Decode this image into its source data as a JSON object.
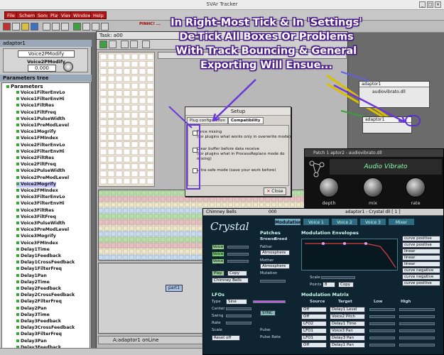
{
  "app": {
    "title": "SVAr Tracker"
  },
  "menu": [
    "File",
    "Scheme",
    "Song",
    "Play",
    "View",
    "Windows",
    "Help"
  ],
  "toolbar": {
    "status": "PINHC! ..."
  },
  "left_panel": {
    "header": "adaptor1",
    "device_name": "Voice2PModify",
    "device_label": "Voice2PModify",
    "device_value": "0.000",
    "tree_header": "Parameters tree",
    "tree_root": "Parameters",
    "items": [
      "Voice1FilterEnvLo",
      "Voice1FilterEnvHi",
      "Voice1FiltRes",
      "Voice1FiltFreq",
      "Voice1PulseWidth",
      "Voice1PreModLevel",
      "Voice1Mogrify",
      "Voice1FMIndex",
      "Voice2FilterEnvLo",
      "Voice2FilterEnvHi",
      "Voice2FiltRes",
      "Voice2FiltFreq",
      "Voice2PulseWidth",
      "Voice2PreModLevel",
      "Voice2Mogrify",
      "Voice2FMIndex",
      "Voice3FilterEnvLo",
      "Voice3FilterEnvHi",
      "Voice3FiltRes",
      "Voice3FiltFreq",
      "Voice3PulseWidth",
      "Voice3PreModLevel",
      "Voice3Mogrify",
      "Voice3FMIndex",
      "Delay1Time",
      "Delay1Feedback",
      "Delay1CrossFeedback",
      "Delay1FilterFreq",
      "Delay1Pan",
      "Delay2Time",
      "Delay2Feedback",
      "Delay2CrossFeedback",
      "Delay2FilterFreq",
      "Delay2Pan",
      "Delay3Time",
      "Delay3Feedback",
      "Delay3CrossFeedback",
      "Delay3FilterFreq",
      "Delay3Pan",
      "Delay3Feedback"
    ],
    "selected_index": 14
  },
  "task": {
    "title": "Task: a00",
    "part_label": "part1",
    "status": "A:adaptor1 onLine"
  },
  "graph": {
    "node1_title": "adaptor1",
    "node1_sub": "audiovibrato.dll",
    "node2_title": "adaptor1"
  },
  "setup": {
    "title": "Setup",
    "tab1": "Plug configuration",
    "tab2": "Compatibility",
    "opt1a": "Force mixing",
    "opt1b": "(for plugins what works only in overwrite mode)",
    "opt2a": "Clear buffer before data receive",
    "opt2b": "(for plugins what in ProcessReplace mode do mixing)",
    "opt3": "Ultra safe mode (save your work before)",
    "close": "Close"
  },
  "patch": {
    "title": "Patch 1   aptor2 - audiovibrato.dll",
    "heading": "Audio Vibrato",
    "knobs": [
      "depth",
      "mix",
      "rate"
    ]
  },
  "crystal": {
    "window_title": "Chimney Bells",
    "window_num": "000",
    "window_right": "adaptor1 - Crystal dll [ 1 ]",
    "logo": "Crystal",
    "tabs": [
      "Modulation",
      "Voice 1",
      "Voice 2",
      "Voice 3",
      "Mixer"
    ],
    "voices": [
      "Voice 1",
      "Voice 2",
      "Voice 3"
    ],
    "buttons": [
      "Play",
      "Copy"
    ],
    "preset": "Chimney Bells",
    "patches_title": "Patches",
    "patches_tabs": [
      "Browse",
      "Breed"
    ],
    "father_label": "Father",
    "father": "Atmosphere",
    "mother_label": "Mother",
    "mother": "Atmosphere",
    "mutation_label": "Mutation",
    "mod_env_title": "Modulation Envelopes",
    "scale_label": "Scale",
    "points_label": "Points",
    "points_value": "8",
    "copy_label": "Copy",
    "curves": [
      "curve positive",
      "curve positive",
      "linear",
      "linear",
      "linear",
      "curve negative",
      "curve negative",
      "curve positive"
    ],
    "lfo_title": "LFOs",
    "lfo_labels": [
      "Type",
      "Center",
      "Swing",
      "Rate",
      "Scale"
    ],
    "lfo_type": "Sine",
    "lfo_scale": "Reset off",
    "pulse_label": "Pulse",
    "pulse_rate_label": "Pulse Rate",
    "sync_label": "SYNC",
    "matrix_title": "Modulation Matrix",
    "matrix_heads": [
      "Source",
      "Target",
      "Low",
      "High"
    ],
    "matrix_rows": [
      [
        "Off",
        "Delay1 Level"
      ],
      [
        "Off",
        "Voice2 Pitch"
      ],
      [
        "LFO2",
        "Delay1 Time"
      ],
      [
        "LFO1",
        "Voice3 Pan"
      ],
      [
        "LFO1",
        "Delay3 Pan"
      ],
      [
        "Off",
        "Delay1 Pan"
      ]
    ]
  },
  "caption": {
    "line1": "In Right-Most Tick & In 'Settings'",
    "line2": "De-Tick All Boxes Or Problems",
    "line3": "With Track Bouncing & General",
    "line4": "Exporting Will Ensue..."
  }
}
